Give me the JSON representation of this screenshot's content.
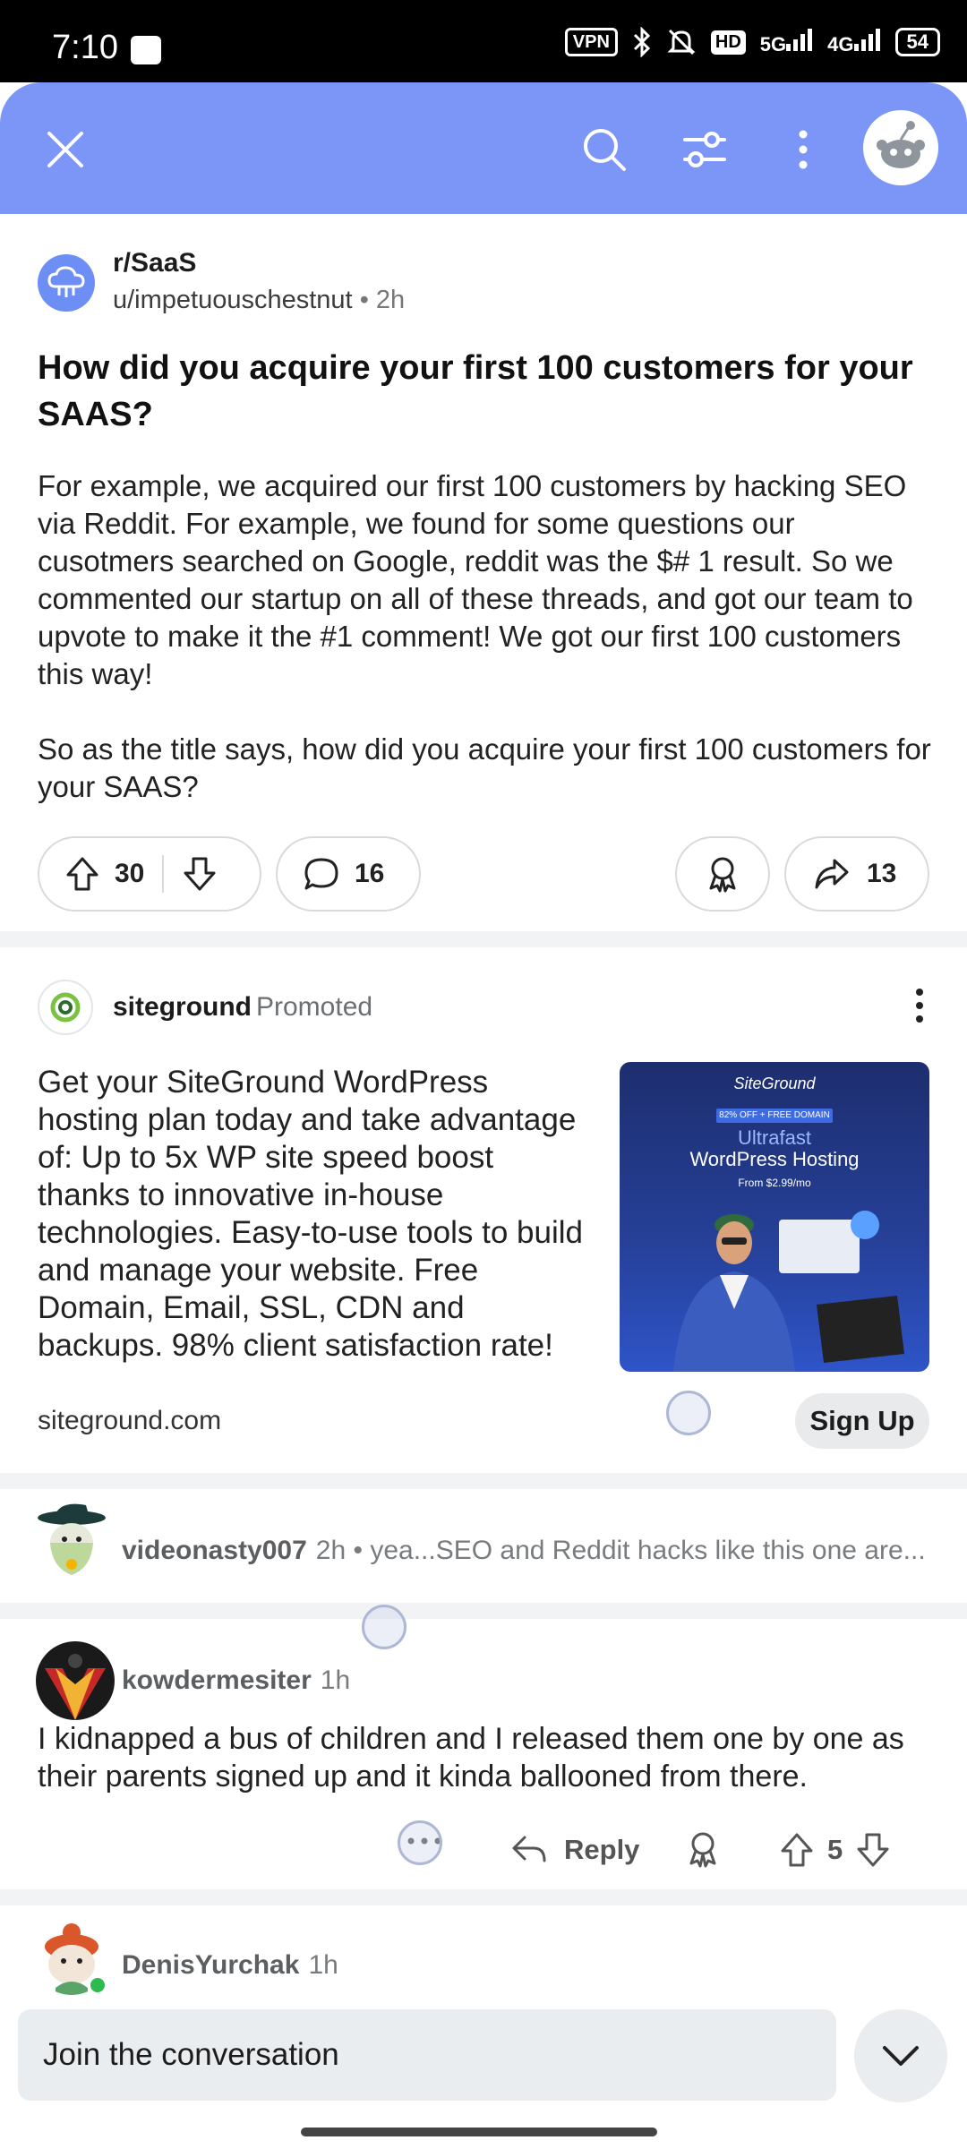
{
  "status_bar": {
    "time": "7:10",
    "vpn": "VPN",
    "hd": "HD",
    "net1": "5G",
    "net2": "4G",
    "battery": "54"
  },
  "topbar": {
    "icons": [
      "close-icon",
      "search-icon",
      "filter-icon",
      "more-vertical-icon",
      "profile-avatar"
    ],
    "bg_color": "#7b96f7"
  },
  "post": {
    "subreddit": "r/SaaS",
    "author": "u/impetuouschestnut",
    "separator": "•",
    "age": "2h",
    "title": "How did you acquire your first 100 customers for your SAAS?",
    "body_p1": "For example, we acquired our first 100 customers by hacking SEO via Reddit. For example, we found for some questions our cusotmers searched on Google, reddit was the $# 1 result. So we commented our startup on all of these threads, and got our team to upvote to make it the #1 comment! We got our first 100 customers this way!",
    "body_p2": "So as the title says, how did you acquire your first 100 customers for your SAAS?",
    "votes": "30",
    "comments": "16",
    "shares": "13"
  },
  "ad": {
    "advertiser": "siteground",
    "promoted_label": "Promoted",
    "text": "Get your SiteGround WordPress hosting plan today and take advantage of: Up to 5x WP site speed boost thanks to innovative in-house technologies. Easy-to-use tools to build and manage your website. Free Domain, Email, SSL, CDN and backups. 98% client satisfaction rate!",
    "domain": "siteground.com",
    "cta": "Sign Up",
    "image": {
      "brand": "SiteGround",
      "badge": "82% OFF + FREE DOMAIN",
      "headline1": "Ultrafast",
      "headline2": "WordPress Hosting",
      "price": "From $2.99/mo"
    }
  },
  "comments": [
    {
      "author": "videonasty007",
      "age": "2h",
      "preview": "• yea...SEO and Reddit hacks like this one are..."
    },
    {
      "author": "kowdermesiter",
      "age": "1h",
      "body": "I kidnapped a bus of children and I released them one by one as their parents signed up and it kinda ballooned from there.",
      "reply_label": "Reply",
      "votes": "5"
    },
    {
      "author": "DenisYurchak",
      "age": "1h"
    }
  ],
  "composer": {
    "placeholder": "Join the conversation"
  }
}
